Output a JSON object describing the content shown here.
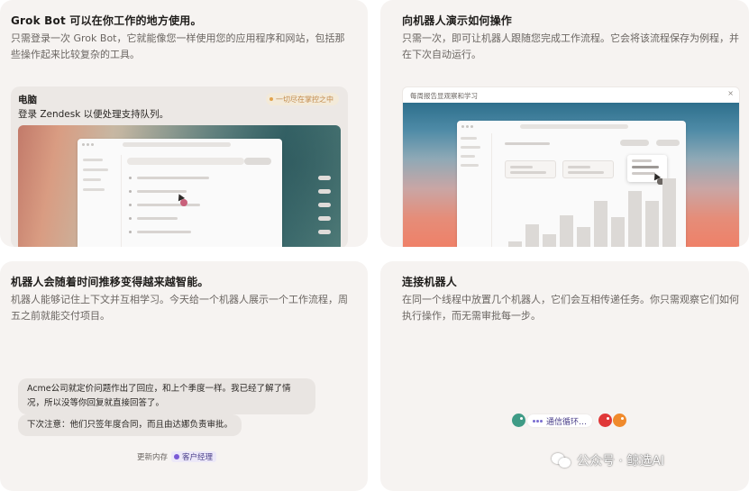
{
  "cards": [
    {
      "title": "Grok Bot 可以在你工作的地方使用。",
      "description": "只需登录一次 Grok Bot，它就能像您一样使用您的应用程序和网站，包括那些操作起来比较复杂的工具。",
      "panel": {
        "label": "电脑",
        "subtitle": "登录 Zendesk 以便处理支持队列。",
        "status": "一切尽在掌控之中"
      }
    },
    {
      "title": "向机器人演示如何操作",
      "description": "只需一次，即可让机器人跟随您完成工作流程。它会将该流程保存为例程，并在下次自动运行。",
      "panel": {
        "header": "每周报告显观察和学习",
        "close_glyph": "×",
        "bar_values": [
          0.12,
          0.26,
          0.18,
          0.34,
          0.24,
          0.46,
          0.32,
          0.54,
          0.46,
          0.64
        ]
      }
    },
    {
      "title": "机器人会随着时间推移变得越来越智能。",
      "description": "机器人能够记住上下文并互相学习。今天给一个机器人展示一个工作流程，周五之前就能交付项目。",
      "chat": {
        "message1": "Acme公司就定价问题作出了回应，和上个季度一样。我已经了解了情况，所以没等你回复就直接回答了。",
        "message2": "下次注意：他们只签年度合同，而且由达娜负责审批。",
        "saved_label": "更新内存",
        "saved_tag": "客户经理"
      }
    },
    {
      "title": "连接机器人",
      "description": "在同一个线程中放置几个机器人，它们会互相传递任务。你只需观察它们如何执行操作，而无需审批每一步。",
      "loop": {
        "label": "通信循环…"
      },
      "watermark": "公众号 · 鲸选AI"
    }
  ],
  "colors": {
    "card_bg": "#f6f3f1",
    "accent_purple": "#7a5ad6",
    "status_orange": "#e2a34d",
    "robot_teal": "#3f9b86",
    "robot_red": "#e03838",
    "robot_orange": "#f08a2c"
  },
  "icons": {
    "cursor": "cursor-arrow-icon",
    "close": "close-icon",
    "wechat": "wechat-icon"
  }
}
